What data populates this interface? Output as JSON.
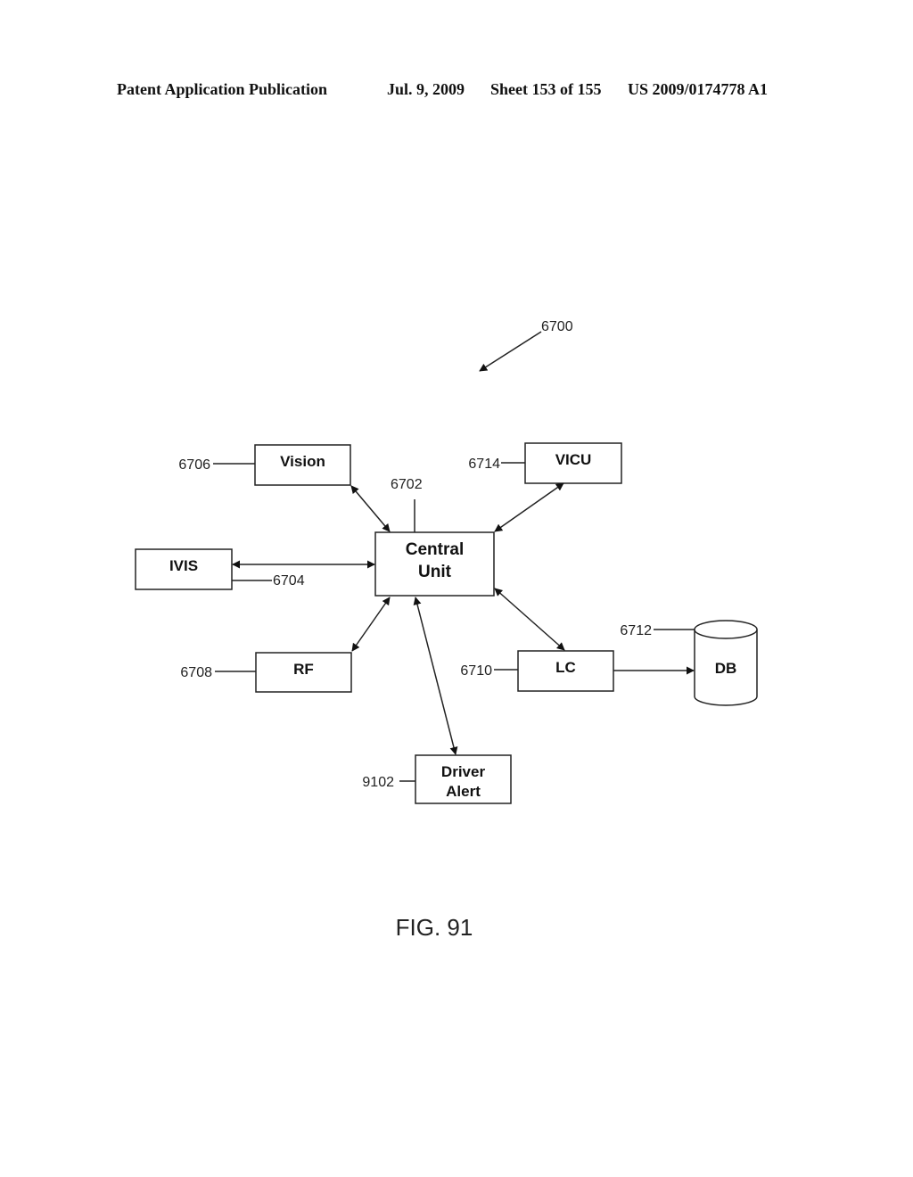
{
  "header": {
    "publication": "Patent Application Publication",
    "date": "Jul. 9, 2009",
    "sheet": "Sheet 153 of 155",
    "number": "US 2009/0174778 A1"
  },
  "diagram": {
    "ref_main": "6700",
    "nodes": {
      "central": {
        "line1": "Central",
        "line2": "Unit",
        "ref": "6702"
      },
      "vision": {
        "label": "Vision",
        "ref": "6706"
      },
      "vicu": {
        "label": "VICU",
        "ref": "6714"
      },
      "ivis": {
        "label": "IVIS",
        "ref": "6704"
      },
      "rf": {
        "label": "RF",
        "ref": "6708"
      },
      "lc": {
        "label": "LC",
        "ref": "6710"
      },
      "db": {
        "label": "DB",
        "ref": "6712"
      },
      "driver_alert": {
        "line1": "Driver",
        "line2": "Alert",
        "ref": "9102"
      }
    },
    "edges": [
      {
        "from": "central",
        "to": "vision",
        "type": "bidirectional"
      },
      {
        "from": "central",
        "to": "vicu",
        "type": "bidirectional"
      },
      {
        "from": "central",
        "to": "ivis",
        "type": "bidirectional"
      },
      {
        "from": "central",
        "to": "rf",
        "type": "bidirectional"
      },
      {
        "from": "central",
        "to": "lc",
        "type": "bidirectional"
      },
      {
        "from": "central",
        "to": "driver_alert",
        "type": "bidirectional"
      },
      {
        "from": "lc",
        "to": "db",
        "type": "directed"
      }
    ]
  },
  "figure_label": "FIG. 91"
}
